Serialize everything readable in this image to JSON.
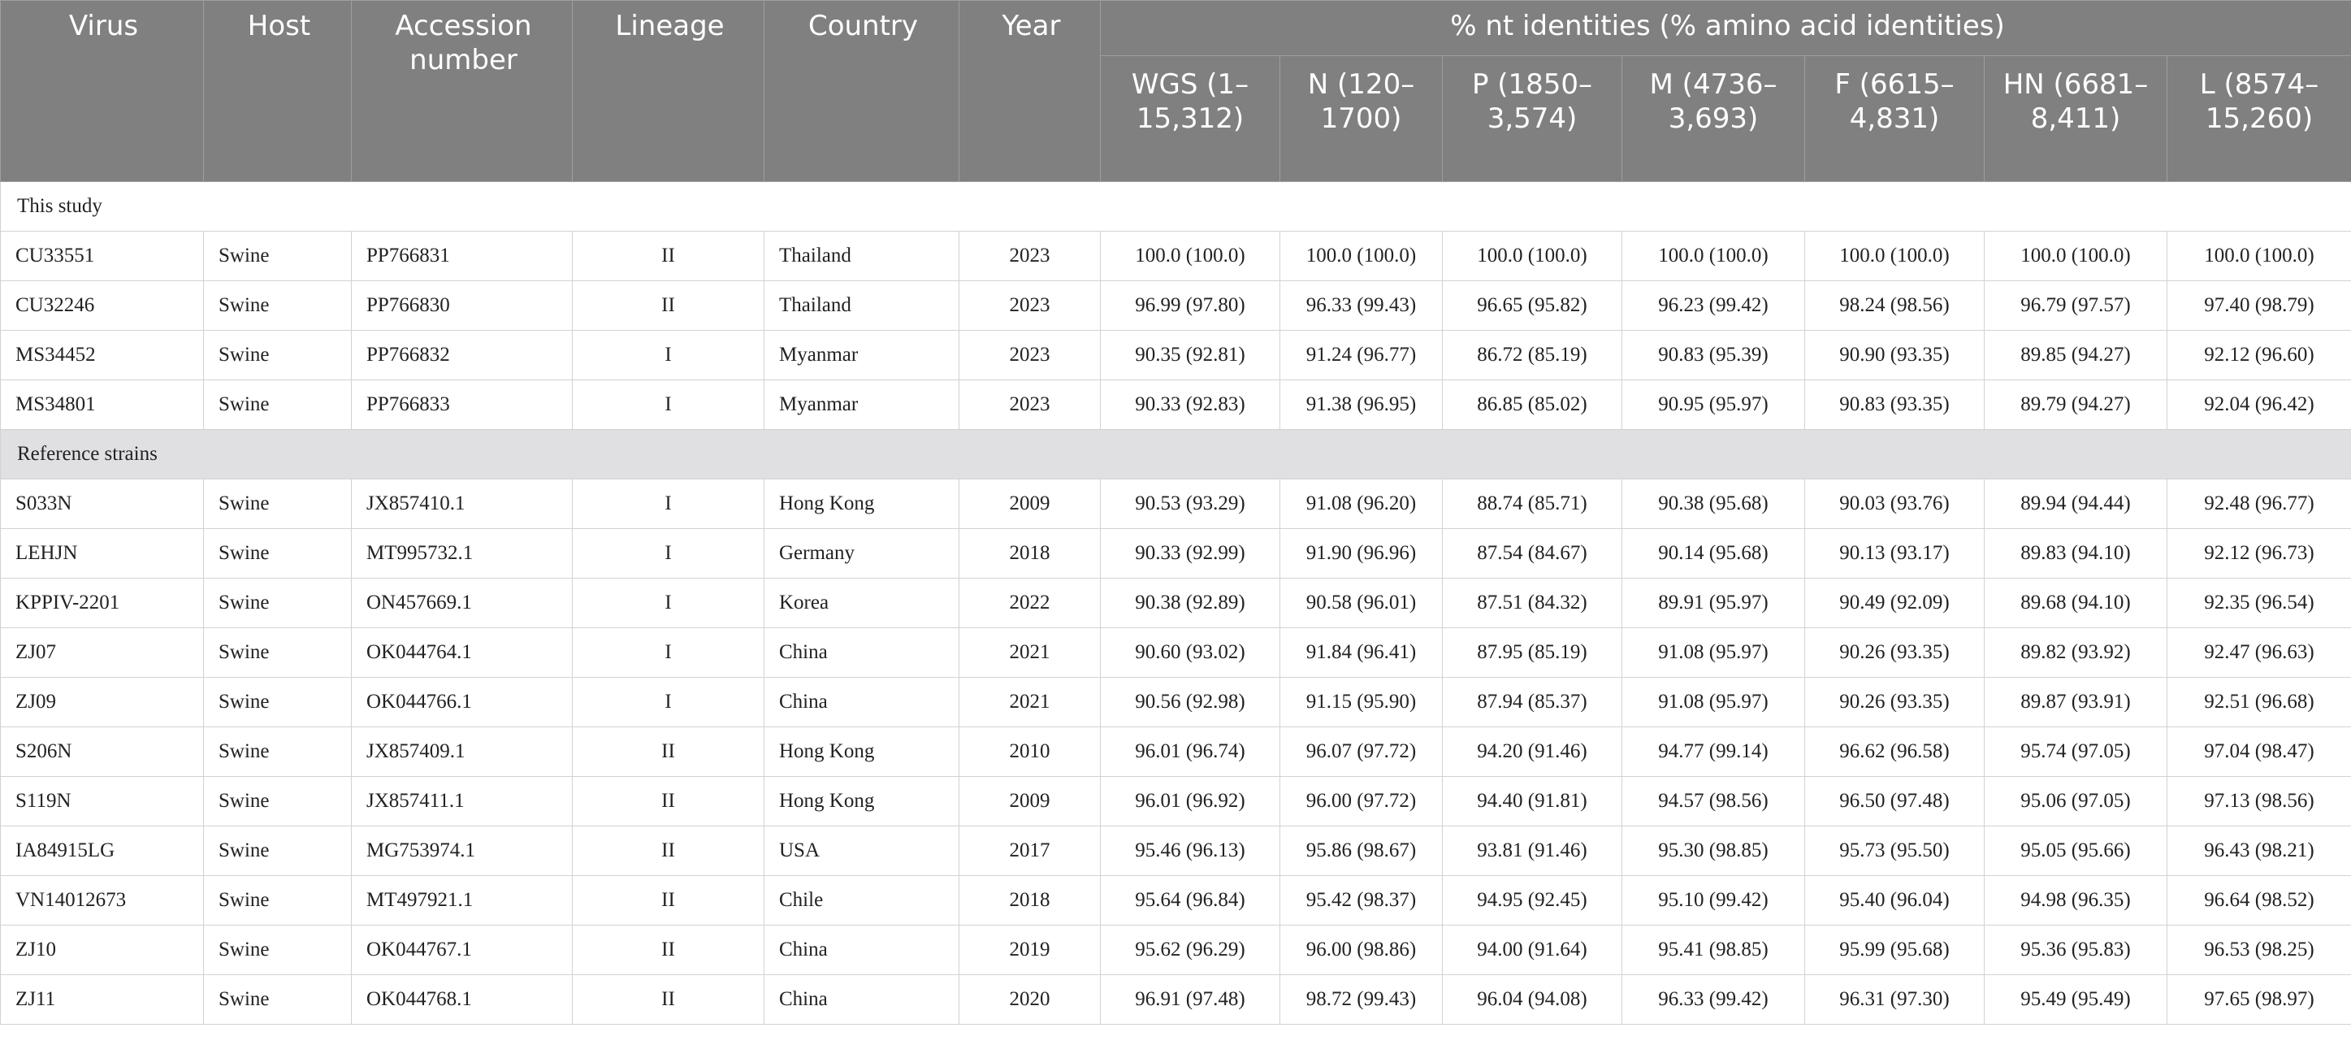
{
  "table": {
    "header": {
      "virus": "Virus",
      "host": "Host",
      "accession": "Accession number",
      "lineage": "Lineage",
      "country": "Country",
      "year": "Year",
      "identities": "% nt identities (% amino acid identities)",
      "wgs": "WGS (1–15,312)",
      "n": "N (120–1700)",
      "p": "P (1850–3,574)",
      "m": "M (4736–3,693)",
      "f": "F (6615–4,831)",
      "hn": "HN (6681–8,411)",
      "l": "L (8574–15,260)"
    },
    "section_study": "This study",
    "section_reference": "Reference strains",
    "study_rows": [
      [
        "CU33551",
        "Swine",
        "PP766831",
        "II",
        "Thailand",
        "2023",
        "100.0 (100.0)",
        "100.0 (100.0)",
        "100.0 (100.0)",
        "100.0 (100.0)",
        "100.0 (100.0)",
        "100.0 (100.0)",
        "100.0 (100.0)"
      ],
      [
        "CU32246",
        "Swine",
        "PP766830",
        "II",
        "Thailand",
        "2023",
        "96.99 (97.80)",
        "96.33 (99.43)",
        "96.65 (95.82)",
        "96.23 (99.42)",
        "98.24 (98.56)",
        "96.79 (97.57)",
        "97.40 (98.79)"
      ],
      [
        "MS34452",
        "Swine",
        "PP766832",
        "I",
        "Myanmar",
        "2023",
        "90.35 (92.81)",
        "91.24 (96.77)",
        "86.72 (85.19)",
        "90.83 (95.39)",
        "90.90 (93.35)",
        "89.85 (94.27)",
        "92.12 (96.60)"
      ],
      [
        "MS34801",
        "Swine",
        "PP766833",
        "I",
        "Myanmar",
        "2023",
        "90.33 (92.83)",
        "91.38 (96.95)",
        "86.85 (85.02)",
        "90.95 (95.97)",
        "90.83 (93.35)",
        "89.79 (94.27)",
        "92.04 (96.42)"
      ]
    ],
    "reference_rows": [
      [
        "S033N",
        "Swine",
        "JX857410.1",
        "I",
        "Hong Kong",
        "2009",
        "90.53 (93.29)",
        "91.08 (96.20)",
        "88.74 (85.71)",
        "90.38 (95.68)",
        "90.03 (93.76)",
        "89.94 (94.44)",
        "92.48 (96.77)"
      ],
      [
        "LEHJN",
        "Swine",
        "MT995732.1",
        "I",
        "Germany",
        "2018",
        "90.33 (92.99)",
        "91.90 (96.96)",
        "87.54 (84.67)",
        "90.14 (95.68)",
        "90.13 (93.17)",
        "89.83 (94.10)",
        "92.12 (96.73)"
      ],
      [
        "KPPIV-2201",
        "Swine",
        "ON457669.1",
        "I",
        "Korea",
        "2022",
        "90.38 (92.89)",
        "90.58 (96.01)",
        "87.51 (84.32)",
        "89.91 (95.97)",
        "90.49 (92.09)",
        "89.68 (94.10)",
        "92.35 (96.54)"
      ],
      [
        "ZJ07",
        "Swine",
        "OK044764.1",
        "I",
        "China",
        "2021",
        "90.60 (93.02)",
        "91.84 (96.41)",
        "87.95 (85.19)",
        "91.08 (95.97)",
        "90.26 (93.35)",
        "89.82 (93.92)",
        "92.47 (96.63)"
      ],
      [
        "ZJ09",
        "Swine",
        "OK044766.1",
        "I",
        "China",
        "2021",
        "90.56 (92.98)",
        "91.15 (95.90)",
        "87.94 (85.37)",
        "91.08 (95.97)",
        "90.26 (93.35)",
        "89.87 (93.91)",
        "92.51 (96.68)"
      ],
      [
        "S206N",
        "Swine",
        "JX857409.1",
        "II",
        "Hong Kong",
        "2010",
        "96.01 (96.74)",
        "96.07 (97.72)",
        "94.20 (91.46)",
        "94.77 (99.14)",
        "96.62 (96.58)",
        "95.74 (97.05)",
        "97.04 (98.47)"
      ],
      [
        "S119N",
        "Swine",
        "JX857411.1",
        "II",
        "Hong Kong",
        "2009",
        "96.01 (96.92)",
        "96.00 (97.72)",
        "94.40 (91.81)",
        "94.57 (98.56)",
        "96.50 (97.48)",
        "95.06 (97.05)",
        "97.13 (98.56)"
      ],
      [
        "IA84915LG",
        "Swine",
        "MG753974.1",
        "II",
        "USA",
        "2017",
        "95.46 (96.13)",
        "95.86 (98.67)",
        "93.81 (91.46)",
        "95.30 (98.85)",
        "95.73 (95.50)",
        "95.05 (95.66)",
        "96.43 (98.21)"
      ],
      [
        "VN14012673",
        "Swine",
        "MT497921.1",
        "II",
        "Chile",
        "2018",
        "95.64 (96.84)",
        "95.42 (98.37)",
        "94.95 (92.45)",
        "95.10 (99.42)",
        "95.40 (96.04)",
        "94.98 (96.35)",
        "96.64 (98.52)"
      ],
      [
        "ZJ10",
        "Swine",
        "OK044767.1",
        "II",
        "China",
        "2019",
        "95.62 (96.29)",
        "96.00 (98.86)",
        "94.00 (91.64)",
        "95.41 (98.85)",
        "95.99 (95.68)",
        "95.36 (95.83)",
        "96.53 (98.25)"
      ],
      [
        "ZJ11",
        "Swine",
        "OK044768.1",
        "II",
        "China",
        "2020",
        "96.91 (97.48)",
        "98.72 (99.43)",
        "96.04 (94.08)",
        "96.33 (99.42)",
        "96.31 (97.30)",
        "95.49 (95.49)",
        "97.65 (98.97)"
      ]
    ]
  }
}
